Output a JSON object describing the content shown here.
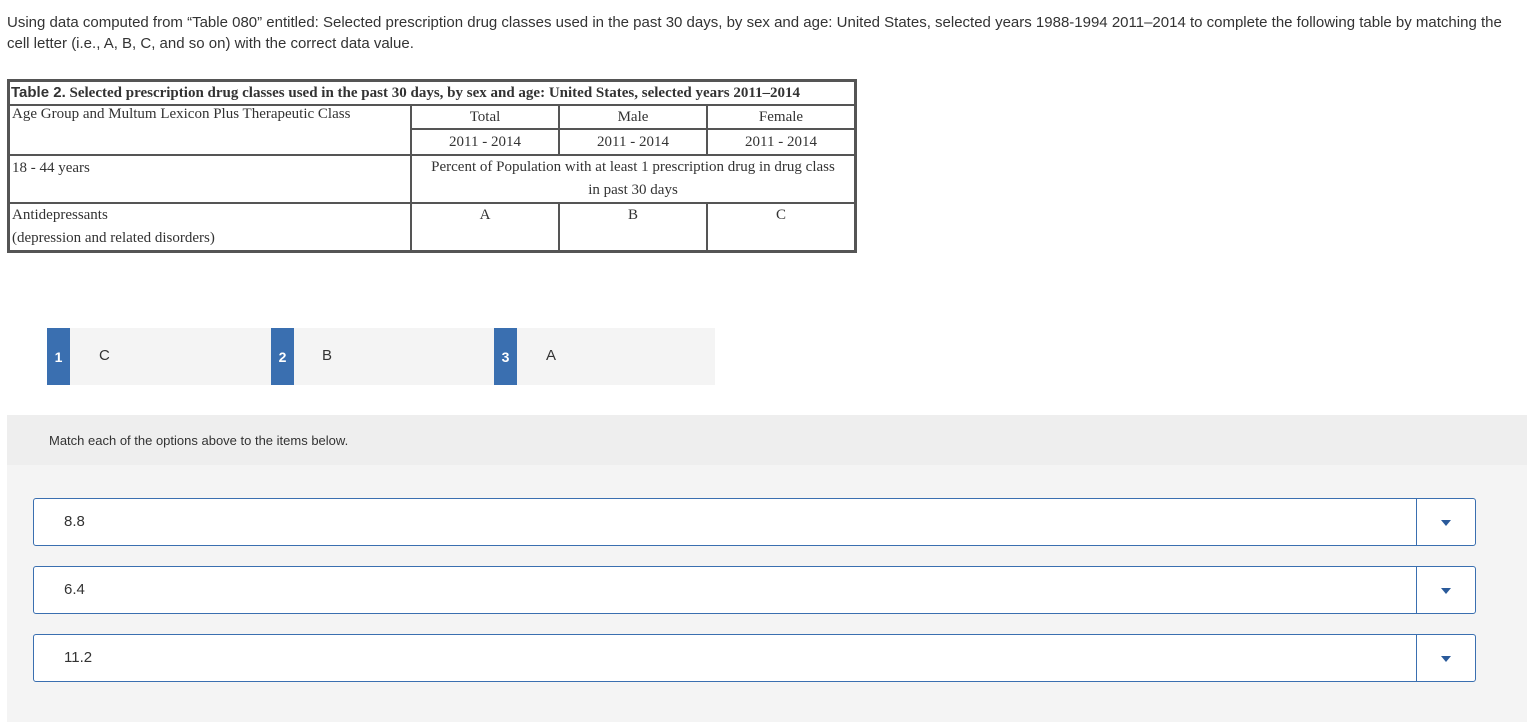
{
  "instructions": "Using data computed from “Table 080” entitled: Selected prescription drug classes used in the past 30 days, by sex and age: United States, selected years 1988-1994 2011–2014 to complete the following table by matching the cell letter (i.e., A, B, C, and so on) with the correct data value.",
  "table": {
    "caption_prefix": "Table 2.",
    "caption_text": "Selected prescription drug classes used in the past 30 days, by sex and age: United States, selected years 2011–2014",
    "row_header": "Age Group and Multum Lexicon Plus Therapeutic Class",
    "columns": [
      "Total",
      "Male",
      "Female"
    ],
    "years": [
      "2011 - 2014",
      "2011 - 2014",
      "2011 - 2014"
    ],
    "age_group": "18 - 44 years",
    "measure": "Percent of Population with at least 1 prescription drug in drug class in past 30 days",
    "class_line1": "Antidepressants",
    "class_line2": "(depression and related disorders)",
    "cells": [
      "A",
      "B",
      "C"
    ]
  },
  "options": [
    {
      "number": "1",
      "label": "C"
    },
    {
      "number": "2",
      "label": "B"
    },
    {
      "number": "3",
      "label": "A"
    }
  ],
  "match_instruction": "Match each of the options above to the items below.",
  "items": [
    {
      "value": "8.8"
    },
    {
      "value": "6.4"
    },
    {
      "value": "11.2"
    }
  ],
  "colors": {
    "accent": "#3a6fb0",
    "panel": "#f4f4f4"
  }
}
